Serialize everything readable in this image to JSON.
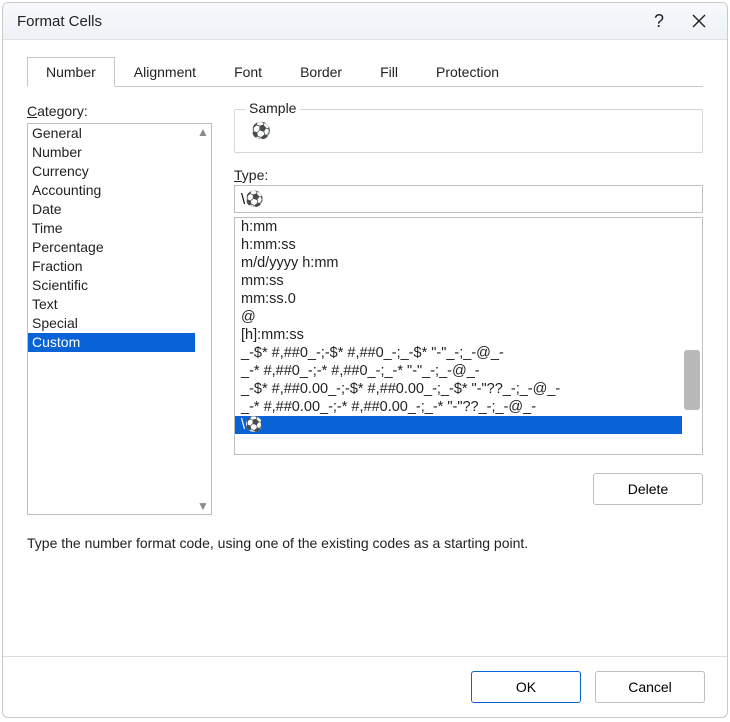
{
  "dialog": {
    "title": "Format Cells",
    "help_label": "?",
    "close_label": "✕"
  },
  "tabs": [
    {
      "label": "Number",
      "active": true
    },
    {
      "label": "Alignment",
      "active": false
    },
    {
      "label": "Font",
      "active": false
    },
    {
      "label": "Border",
      "active": false
    },
    {
      "label": "Fill",
      "active": false
    },
    {
      "label": "Protection",
      "active": false
    }
  ],
  "category": {
    "label_prefix": "C",
    "label_rest": "ategory:",
    "items": [
      {
        "label": "General",
        "selected": false
      },
      {
        "label": "Number",
        "selected": false
      },
      {
        "label": "Currency",
        "selected": false
      },
      {
        "label": "Accounting",
        "selected": false
      },
      {
        "label": "Date",
        "selected": false
      },
      {
        "label": "Time",
        "selected": false
      },
      {
        "label": "Percentage",
        "selected": false
      },
      {
        "label": "Fraction",
        "selected": false
      },
      {
        "label": "Scientific",
        "selected": false
      },
      {
        "label": "Text",
        "selected": false
      },
      {
        "label": "Special",
        "selected": false
      },
      {
        "label": "Custom",
        "selected": true
      }
    ]
  },
  "sample": {
    "legend": "Sample",
    "value": "⚽"
  },
  "type": {
    "label_prefix": "T",
    "label_rest": "ype:",
    "input_value": "\\⚽",
    "items": [
      {
        "label": "h:mm",
        "selected": false
      },
      {
        "label": "h:mm:ss",
        "selected": false
      },
      {
        "label": "m/d/yyyy h:mm",
        "selected": false
      },
      {
        "label": "mm:ss",
        "selected": false
      },
      {
        "label": "mm:ss.0",
        "selected": false
      },
      {
        "label": "@",
        "selected": false
      },
      {
        "label": "[h]:mm:ss",
        "selected": false
      },
      {
        "label": "_-$* #,##0_-;-$* #,##0_-;_-$* \"-\"_-;_-@_-",
        "selected": false
      },
      {
        "label": "_-* #,##0_-;-* #,##0_-;_-* \"-\"_-;_-@_-",
        "selected": false
      },
      {
        "label": "_-$* #,##0.00_-;-$* #,##0.00_-;_-$* \"-\"??_-;_-@_-",
        "selected": false
      },
      {
        "label": "_-* #,##0.00_-;-* #,##0.00_-;_-* \"-\"??_-;_-@_-",
        "selected": false
      },
      {
        "label": "\\⚽",
        "selected": true
      }
    ]
  },
  "buttons": {
    "delete": "Delete",
    "ok": "OK",
    "cancel": "Cancel"
  },
  "helptext": "Type the number format code, using one of the existing codes as a starting point."
}
